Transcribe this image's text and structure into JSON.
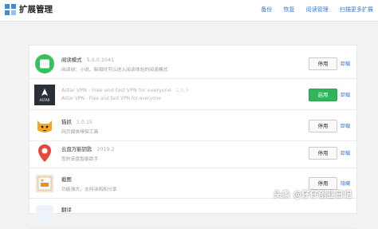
{
  "header": {
    "title": "扩展管理",
    "nav": [
      "备份",
      "恢复",
      "阅读管理",
      "扫描更多扩展"
    ]
  },
  "extensions": [
    {
      "name": "阅读模式",
      "version": "5.0.0.1041",
      "description": "阅读前：小说、新闻时可以进入阅读体验的阅读模式",
      "button": "停用",
      "uninstall": "卸载",
      "enabled": true
    },
    {
      "name": "Astar VPN - Free and fast VPN for everyone",
      "version": "1.0.5",
      "description": "Astar VPN - Free and fast VPN for everyone",
      "button": "启用",
      "uninstall": "卸载",
      "enabled": false
    },
    {
      "name": "猫抓",
      "version": "1.0.15",
      "description": "网页媒体嗅探工具",
      "button": "停用",
      "uninstall": "卸载",
      "enabled": true
    },
    {
      "name": "云盘万能钥匙",
      "version": "2019.2",
      "description": "您的云盘智能助手",
      "button": "停用",
      "uninstall": "卸载",
      "enabled": true
    },
    {
      "name": "截图",
      "version": "",
      "description": "功能强大，支持涂鸦和分享",
      "button": "停用",
      "uninstall": "隐藏",
      "enabled": true
    },
    {
      "name": "翻译",
      "version": "",
      "description": "",
      "button": "",
      "uninstall": "",
      "enabled": true
    }
  ],
  "watermark": "头条 @仔仔创业日记",
  "icons": [
    "grid-icon",
    "reader-icon",
    "astar-icon",
    "cat-icon",
    "map-pin-icon",
    "screenshot-icon",
    "translate-icon"
  ],
  "colors": {
    "accent": "#3a78d4",
    "enable_button": "#31b55a"
  }
}
